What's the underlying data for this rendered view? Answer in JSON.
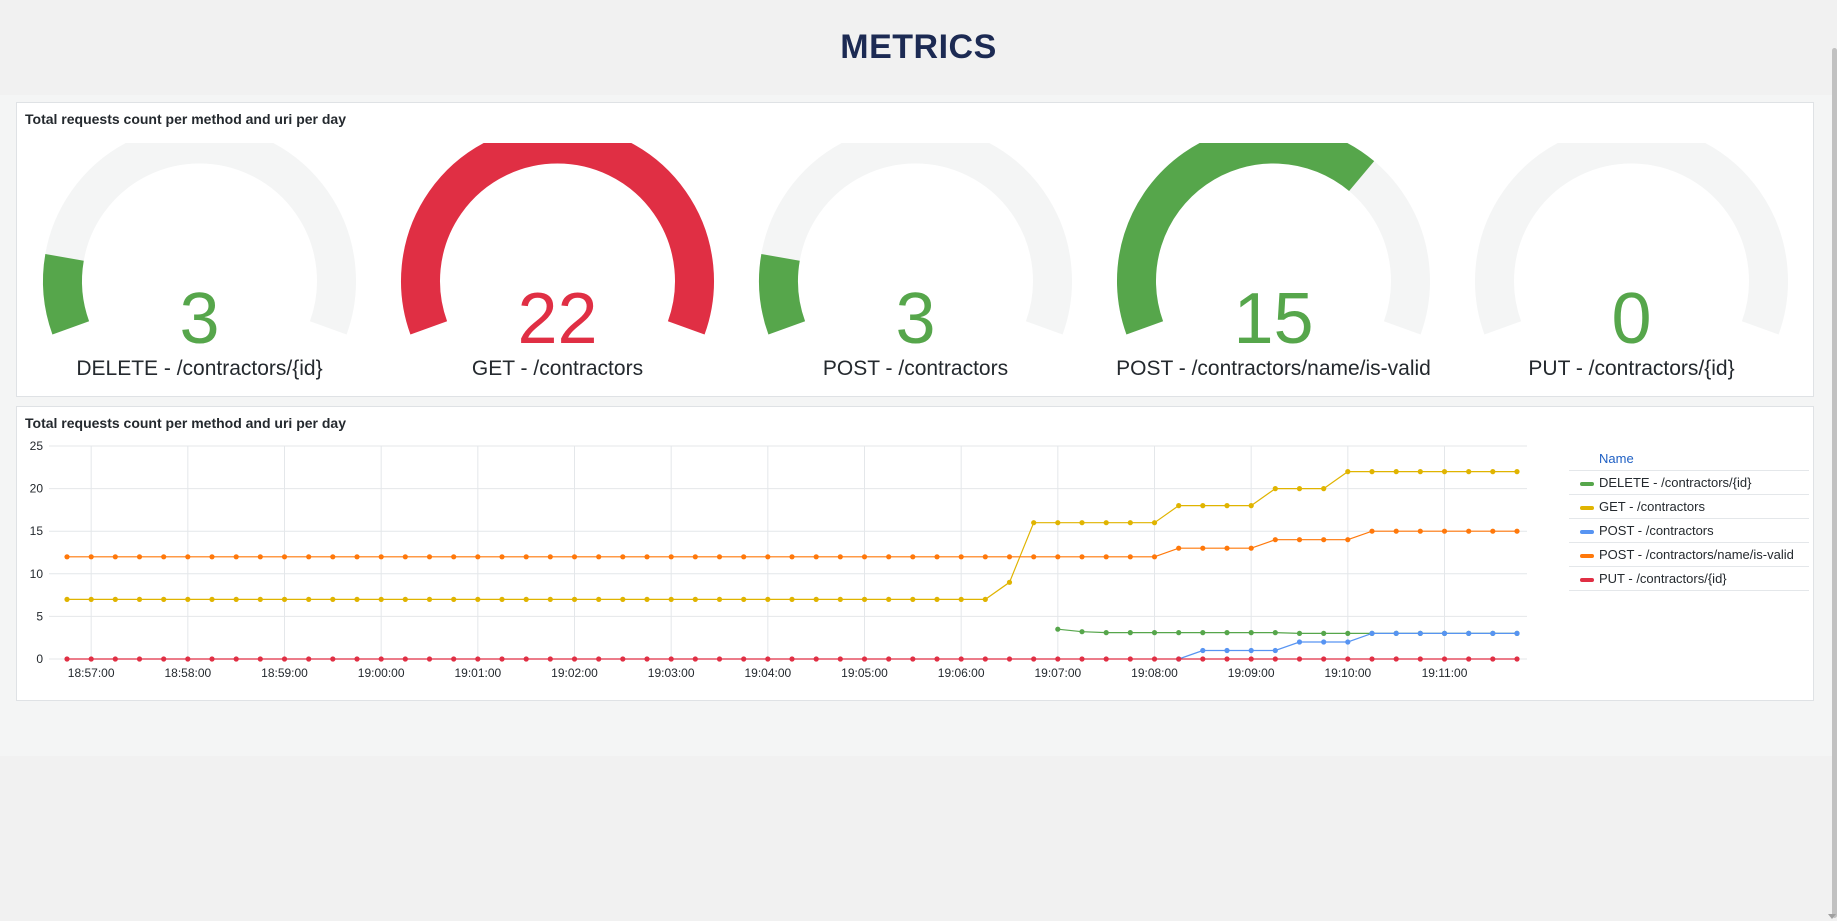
{
  "page": {
    "title": "METRICS"
  },
  "colors": {
    "green": "#56a64b",
    "red": "#e02f44",
    "track": "#f4f5f5",
    "yellow": "#e0b400",
    "blue": "#5794f2",
    "orange": "#ff780a"
  },
  "gauge_panel": {
    "title": "Total requests count per method and uri per day",
    "gauges": [
      {
        "value": "3",
        "label": "DELETE - /contractors/{id}",
        "fraction": 0.136,
        "color": "#56a64b"
      },
      {
        "value": "22",
        "label": "GET - /contractors",
        "fraction": 1.0,
        "color": "#e02f44"
      },
      {
        "value": "3",
        "label": "POST - /contractors",
        "fraction": 0.136,
        "color": "#56a64b"
      },
      {
        "value": "15",
        "label": "POST - /contractors/name/is-valid",
        "fraction": 0.682,
        "color": "#56a64b"
      },
      {
        "value": "0",
        "label": "PUT - /contractors/{id}",
        "fraction": 0.0,
        "color": "#56a64b"
      }
    ]
  },
  "timeseries_panel": {
    "title": "Total requests count per method and uri per day",
    "legend_header": "Name"
  },
  "chart_data": {
    "type": "line",
    "x": [
      "18:56:45",
      "18:57:00",
      "18:57:15",
      "18:57:30",
      "18:57:45",
      "18:58:00",
      "18:58:15",
      "18:58:30",
      "18:58:45",
      "18:59:00",
      "18:59:15",
      "18:59:30",
      "18:59:45",
      "19:00:00",
      "19:00:15",
      "19:00:30",
      "19:00:45",
      "19:01:00",
      "19:01:15",
      "19:01:30",
      "19:01:45",
      "19:02:00",
      "19:02:15",
      "19:02:30",
      "19:02:45",
      "19:03:00",
      "19:03:15",
      "19:03:30",
      "19:03:45",
      "19:04:00",
      "19:04:15",
      "19:04:30",
      "19:04:45",
      "19:05:00",
      "19:05:15",
      "19:05:30",
      "19:05:45",
      "19:06:00",
      "19:06:15",
      "19:06:30",
      "19:06:45",
      "19:07:00",
      "19:07:15",
      "19:07:30",
      "19:07:45",
      "19:08:00",
      "19:08:15",
      "19:08:30",
      "19:08:45",
      "19:09:00",
      "19:09:15",
      "19:09:30",
      "19:09:45",
      "19:10:00",
      "19:10:15",
      "19:10:30",
      "19:10:45",
      "19:11:00",
      "19:11:15",
      "19:11:30",
      "19:11:45"
    ],
    "xticks": [
      "18:57:00",
      "18:58:00",
      "18:59:00",
      "19:00:00",
      "19:01:00",
      "19:02:00",
      "19:03:00",
      "19:04:00",
      "19:05:00",
      "19:06:00",
      "19:07:00",
      "19:08:00",
      "19:09:00",
      "19:10:00",
      "19:11:00"
    ],
    "ylim": [
      0,
      25
    ],
    "yticks": [
      "0",
      "5",
      "10",
      "15",
      "20",
      "25"
    ],
    "grid": true,
    "legend_position": "right",
    "series": [
      {
        "name": "DELETE - /contractors/{id}",
        "color": "#56a64b",
        "values": [
          null,
          null,
          null,
          null,
          null,
          null,
          null,
          null,
          null,
          null,
          null,
          null,
          null,
          null,
          null,
          null,
          null,
          null,
          null,
          null,
          null,
          null,
          null,
          null,
          null,
          null,
          null,
          null,
          null,
          null,
          null,
          null,
          null,
          null,
          null,
          null,
          null,
          null,
          null,
          null,
          null,
          3.5,
          3.2,
          3.1,
          3.1,
          3.1,
          3.1,
          3.1,
          3.1,
          3.1,
          3.1,
          3,
          3,
          3,
          3,
          3,
          3,
          3,
          3,
          3,
          3
        ]
      },
      {
        "name": "GET - /contractors",
        "color": "#e0b400",
        "values": [
          7,
          7,
          7,
          7,
          7,
          7,
          7,
          7,
          7,
          7,
          7,
          7,
          7,
          7,
          7,
          7,
          7,
          7,
          7,
          7,
          7,
          7,
          7,
          7,
          7,
          7,
          7,
          7,
          7,
          7,
          7,
          7,
          7,
          7,
          7,
          7,
          7,
          7,
          7,
          9,
          16,
          16,
          16,
          16,
          16,
          16,
          18,
          18,
          18,
          18,
          20,
          20,
          20,
          22,
          22,
          22,
          22,
          22,
          22,
          22,
          22
        ]
      },
      {
        "name": "POST - /contractors",
        "color": "#5794f2",
        "values": [
          null,
          null,
          null,
          null,
          null,
          null,
          null,
          null,
          null,
          null,
          null,
          null,
          null,
          null,
          null,
          null,
          null,
          null,
          null,
          null,
          null,
          null,
          null,
          null,
          null,
          null,
          null,
          null,
          null,
          null,
          null,
          null,
          null,
          null,
          null,
          null,
          null,
          null,
          null,
          null,
          null,
          null,
          null,
          null,
          null,
          null,
          0,
          1,
          1,
          1,
          1,
          2,
          2,
          2,
          3,
          3,
          3,
          3,
          3,
          3,
          3
        ]
      },
      {
        "name": "POST - /contractors/name/is-valid",
        "color": "#ff780a",
        "values": [
          12,
          12,
          12,
          12,
          12,
          12,
          12,
          12,
          12,
          12,
          12,
          12,
          12,
          12,
          12,
          12,
          12,
          12,
          12,
          12,
          12,
          12,
          12,
          12,
          12,
          12,
          12,
          12,
          12,
          12,
          12,
          12,
          12,
          12,
          12,
          12,
          12,
          12,
          12,
          12,
          12,
          12,
          12,
          12,
          12,
          12,
          13,
          13,
          13,
          13,
          14,
          14,
          14,
          14,
          15,
          15,
          15,
          15,
          15,
          15,
          15
        ]
      },
      {
        "name": "PUT - /contractors/{id}",
        "color": "#e02f44",
        "values": [
          0,
          0,
          0,
          0,
          0,
          0,
          0,
          0,
          0,
          0,
          0,
          0,
          0,
          0,
          0,
          0,
          0,
          0,
          0,
          0,
          0,
          0,
          0,
          0,
          0,
          0,
          0,
          0,
          0,
          0,
          0,
          0,
          0,
          0,
          0,
          0,
          0,
          0,
          0,
          0,
          0,
          0,
          0,
          0,
          0,
          0,
          0,
          0,
          0,
          0,
          0,
          0,
          0,
          0,
          0,
          0,
          0,
          0,
          0,
          0,
          0
        ]
      }
    ]
  }
}
